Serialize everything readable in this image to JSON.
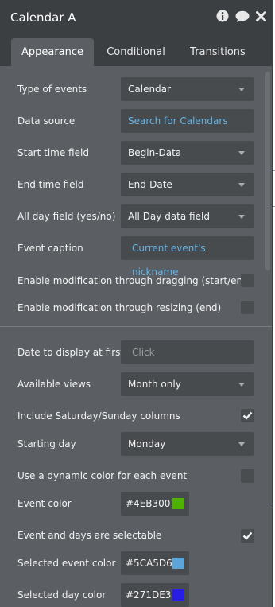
{
  "header": {
    "title": "Calendar A"
  },
  "tabs": [
    {
      "label": "Appearance"
    },
    {
      "label": "Conditional"
    },
    {
      "label": "Transitions"
    }
  ],
  "fields": {
    "type_of_events": {
      "label": "Type of events",
      "value": "Calendar"
    },
    "data_source": {
      "label": "Data source",
      "value": "Search for Calendars"
    },
    "start_time": {
      "label": "Start time field",
      "value": "Begin-Data"
    },
    "end_time": {
      "label": "End time field",
      "value": "End-Date"
    },
    "all_day": {
      "label": "All day field (yes/no)",
      "value": "All Day data field"
    },
    "event_caption": {
      "label": "Event caption",
      "value": "Current event's nickname"
    },
    "drag_mod": {
      "label": "Enable modification through dragging (start/end)",
      "checked": false
    },
    "resize_mod": {
      "label": "Enable modification through resizing (end)",
      "checked": false
    },
    "date_first": {
      "label": "Date to display at first",
      "placeholder": "Click"
    },
    "available_views": {
      "label": "Available views",
      "value": "Month only"
    },
    "weekend_cols": {
      "label": "Include Saturday/Sunday columns",
      "checked": true
    },
    "starting_day": {
      "label": "Starting day",
      "value": "Monday"
    },
    "dynamic_color": {
      "label": "Use a dynamic color for each event",
      "checked": false
    },
    "event_color": {
      "label": "Event color",
      "value": "#4EB300",
      "color": "#4EB300"
    },
    "selectable": {
      "label": "Event and days are selectable",
      "checked": true
    },
    "selected_event_color": {
      "label": "Selected event color",
      "value": "#5CA5D6",
      "color": "#5CA5D6"
    },
    "selected_day_color": {
      "label": "Selected day color",
      "value": "#271DE3",
      "color": "#271DE3"
    }
  },
  "icons": [
    "info-icon",
    "comment-icon",
    "close-icon",
    "chevron-down-icon",
    "checkmark-icon"
  ]
}
